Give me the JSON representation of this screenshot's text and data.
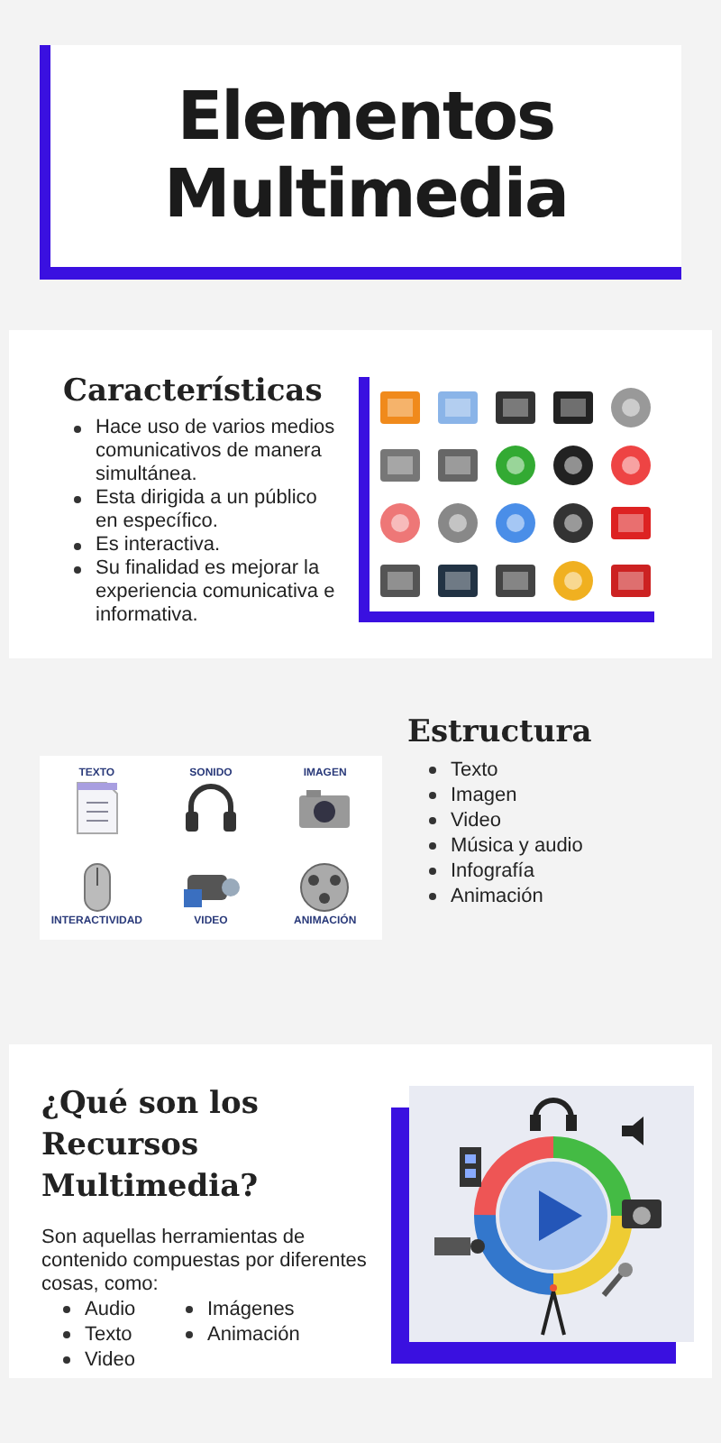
{
  "title": {
    "lines": [
      "Elementos",
      "Multimedia"
    ]
  },
  "caracteristicas": {
    "heading": "Características",
    "items": [
      "Hace uso de varios medios comunicativos de manera simultánea.",
      "Esta dirigida a un público en específico.",
      "Es interactiva.",
      "Su finalidad es mejorar la experiencia comunicativa e informativa."
    ]
  },
  "estructura": {
    "image_labels": [
      "TEXTO",
      "SONIDO",
      "IMAGEN",
      "INTERACTIVIDAD",
      "VIDEO",
      "ANIMACIÓN"
    ],
    "heading": "Estructura",
    "items": [
      "Texto",
      "Imagen",
      "Video",
      "Música y audio",
      "Infografía",
      "Animación"
    ]
  },
  "recursos": {
    "heading": "¿Qué son los Recursos Multimedia?",
    "text": "Son aquellas herramientas de contenido compuestas por diferentes cosas, como:",
    "column_1": [
      "Audio",
      "Texto",
      "Video"
    ],
    "column_2": [
      "Imágenes",
      "Animación"
    ]
  }
}
